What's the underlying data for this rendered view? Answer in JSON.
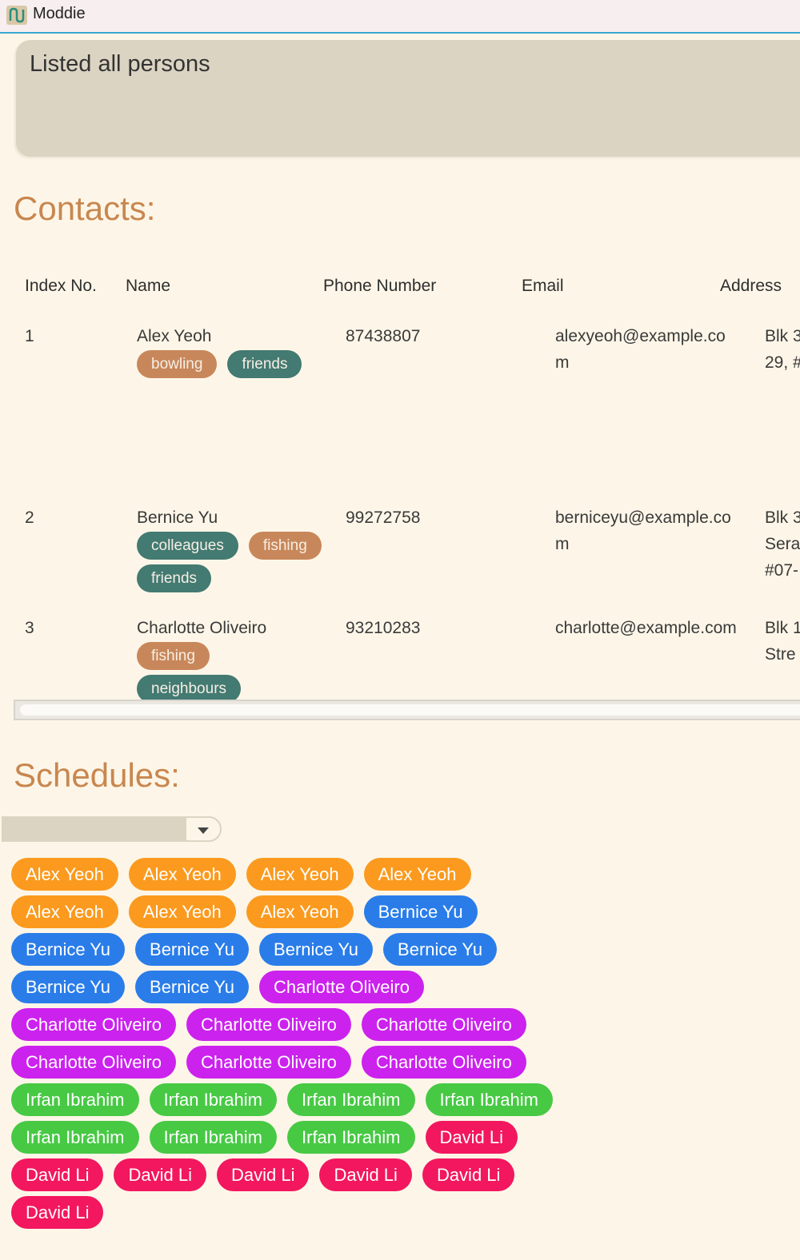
{
  "window": {
    "title": "Moddie"
  },
  "result": {
    "message": "Listed all persons"
  },
  "contacts": {
    "title": "Contacts:",
    "columns": [
      "Index No.",
      "Name",
      "Phone Number",
      "Email",
      "Address"
    ],
    "rows": [
      {
        "index": "1",
        "name": "Alex Yeoh",
        "phone": "87438807",
        "email": "alexyeoh@example.com",
        "address_lines": [
          "Blk 3",
          "29, #"
        ],
        "tags": [
          {
            "label": "bowling",
            "style": "warm"
          },
          {
            "label": "friends",
            "style": "cool"
          }
        ]
      },
      {
        "index": "2",
        "name": "Bernice Yu",
        "phone": "99272758",
        "email": "berniceyu@example.com",
        "address_lines": [
          "Blk 3",
          "Sera",
          "#07-"
        ],
        "tags": [
          {
            "label": "colleagues",
            "style": "cool"
          },
          {
            "label": "fishing",
            "style": "warm"
          },
          {
            "label": "friends",
            "style": "cool"
          }
        ]
      },
      {
        "index": "3",
        "name": "Charlotte Oliveiro",
        "phone": "93210283",
        "email": "charlotte@example.com",
        "address_lines": [
          "Blk 1",
          "Stre"
        ],
        "tags": [
          {
            "label": "fishing",
            "style": "warm"
          },
          {
            "label": "neighbours",
            "style": "cool"
          }
        ]
      }
    ]
  },
  "schedules": {
    "title": "Schedules:",
    "selector_value": "",
    "colors": {
      "Alex Yeoh": "#fb9a1e",
      "Bernice Yu": "#2a7de9",
      "Charlotte Oliveiro": "#cc22ee",
      "Irfan Ibrahim": "#47c944",
      "David Li": "#f2175f"
    },
    "entries": [
      "Alex Yeoh",
      "Alex Yeoh",
      "Alex Yeoh",
      "Alex Yeoh",
      "Alex Yeoh",
      "Alex Yeoh",
      "Alex Yeoh",
      "Bernice Yu",
      "Bernice Yu",
      "Bernice Yu",
      "Bernice Yu",
      "Bernice Yu",
      "Bernice Yu",
      "Bernice Yu",
      "Charlotte Oliveiro",
      "Charlotte Oliveiro",
      "Charlotte Oliveiro",
      "Charlotte Oliveiro",
      "Charlotte Oliveiro",
      "Charlotte Oliveiro",
      "Charlotte Oliveiro",
      "Irfan Ibrahim",
      "Irfan Ibrahim",
      "Irfan Ibrahim",
      "Irfan Ibrahim",
      "Irfan Ibrahim",
      "Irfan Ibrahim",
      "Irfan Ibrahim",
      "David Li",
      "David Li",
      "David Li",
      "David Li",
      "David Li",
      "David Li",
      "David Li"
    ]
  }
}
